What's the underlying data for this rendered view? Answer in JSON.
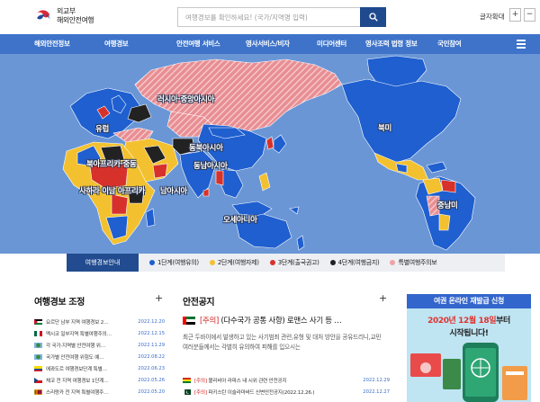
{
  "header": {
    "logo_line1": "외교부",
    "logo_line2": "해외안전여행",
    "search_placeholder": "여행경보를 확인하세요! (국가/지역명 입력)",
    "font_size_label": "글자확대",
    "zoom_in": "+",
    "zoom_out": "−"
  },
  "nav": {
    "items": [
      "해외안전정보",
      "여행경보",
      "안전여행 서비스",
      "영사서비스/비자",
      "미디어센터",
      "영사조력 법령 정보",
      "국민참여"
    ]
  },
  "map": {
    "regions": [
      "러시아·중앙아시아",
      "유럽",
      "동북아시아",
      "북아프리카·중동",
      "동남아시아",
      "사하라 이남 아프리카",
      "남아시아",
      "오세아니아",
      "북미",
      "중남미"
    ]
  },
  "legend": {
    "title": "여행경보안내",
    "items": [
      {
        "label": "1단계(여행유의)",
        "color": "#1f5fcf"
      },
      {
        "label": "2단계(여행자제)",
        "color": "#f3c12f"
      },
      {
        "label": "3단계(출국권고)",
        "color": "#d6322b"
      },
      {
        "label": "4단계(여행금지)",
        "color": "#222222"
      },
      {
        "label": "특별여행주의보",
        "color": "#f0a3a6"
      }
    ]
  },
  "alerts": {
    "title": "여행경보 조정",
    "more": "+",
    "items": [
      {
        "text": "요르단 남부 지역 여행경보 2…",
        "date": "2022.12.20",
        "flag": "jordan"
      },
      {
        "text": "멕시코 일부지역 특별여행주의…",
        "date": "2022.12.15",
        "flag": "mexico"
      },
      {
        "text": "각 국가·지역별 안전여행 위…",
        "date": "2022.11.29",
        "flag": "globe"
      },
      {
        "text": "국가별 안전여행 위험도 예…",
        "date": "2022.08.22",
        "flag": "globe"
      },
      {
        "text": "에콰도르 여행경보단계 특별…",
        "date": "2022.06.23",
        "flag": "ecuador"
      },
      {
        "text": "체코 전 지역 여행경보 1단계…",
        "date": "2022.05.26",
        "flag": "czech"
      },
      {
        "text": "스리랑카 전 지역 특별여행주…",
        "date": "2022.05.20",
        "flag": "srilanka"
      }
    ]
  },
  "safety": {
    "title": "안전공지",
    "more": "+",
    "featured": {
      "tag": "[주의]",
      "title": "(다수국가 공통 사항) 로맨스 사기 등 …",
      "body": "최근 두바이에서 발생하고 있는 사기범죄 관련,유형 및 대처 방안을 공유드리니,교민 여러분들께서는 각별히 유의하여 피해를 입으시는"
    },
    "items": [
      {
        "tag": "[주의]",
        "text": "볼리비아 라파스 내 시위 관련 안전공지",
        "date": "2022.12.29",
        "flag": "bolivia"
      },
      {
        "tag": "[주의]",
        "text": "파키스탄 이슬라마바드 신변안전공지(2022.12.26.)",
        "date": "2022.12.27",
        "flag": "pakistan"
      }
    ]
  },
  "banner": {
    "line1": "여권 온라인 재발급 신청",
    "date_highlight": "2020년 12월 18일",
    "line2_suffix": "부터",
    "line3": "시작됩니다!"
  },
  "colors": {
    "nav_bg": "#3e73c9",
    "level1": "#1f5fcf",
    "level2": "#f3c12f",
    "level3": "#d6322b",
    "level4": "#222222",
    "special": "#f0a3a6",
    "ocean": "#6a96d6"
  }
}
